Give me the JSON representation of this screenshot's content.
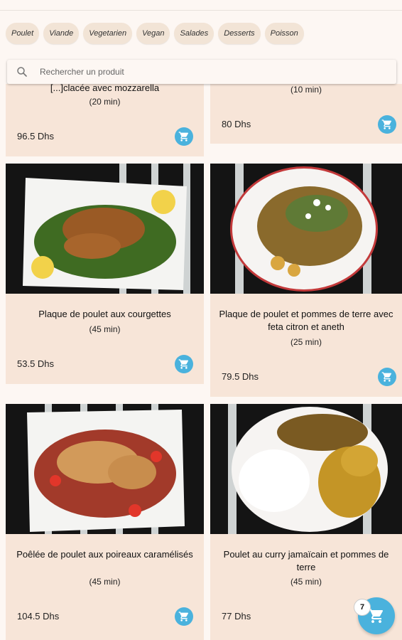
{
  "categories": [
    "Poulet",
    "Viande",
    "Vegetarien",
    "Vegan",
    "Salades",
    "Desserts",
    "Poisson"
  ],
  "search": {
    "placeholder": "Rechercher un produit"
  },
  "products": [
    {
      "title": "[...]clacée avec mozzarella",
      "time": "(20 min)",
      "price": "96.5 Dhs"
    },
    {
      "title": "",
      "time": "(10 min)",
      "price": "80 Dhs"
    },
    {
      "title": "Plaque de poulet aux courgettes",
      "time": "(45 min)",
      "price": "53.5 Dhs"
    },
    {
      "title": "Plaque de poulet et pommes de terre avec feta citron et aneth",
      "time": "(25 min)",
      "price": "79.5 Dhs"
    },
    {
      "title": "Poêlée de poulet aux poireaux caramélisés",
      "time": "(45 min)",
      "price": "104.5 Dhs"
    },
    {
      "title": "Poulet au curry jamaïcain et pommes de terre",
      "time": "(45 min)",
      "price": "77 Dhs"
    }
  ],
  "cart": {
    "count": "7"
  },
  "icons": {
    "search": "search-icon",
    "cart": "cart-icon"
  },
  "colors": {
    "accent": "#4ab2dd",
    "card": "#f7e5d8",
    "chip": "#f2e4d6",
    "background": "#fdf7f3"
  }
}
